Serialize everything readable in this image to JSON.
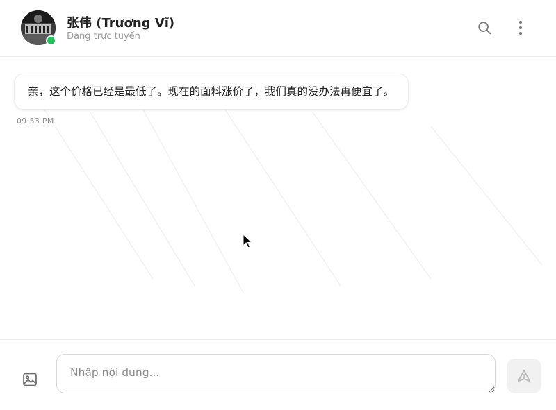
{
  "header": {
    "contact_name": "张伟 (Trương Vĩ)",
    "status": "Đang trực tuyến",
    "online_color": "#22c55e",
    "icons": [
      "avatar",
      "search-icon",
      "more-vertical-icon"
    ]
  },
  "messages": [
    {
      "direction": "incoming",
      "text": "亲，这个价格已经是最低了。现在的面料涨价了，我们真的没办法再便宜了。",
      "time": "09:53 PM"
    }
  ],
  "composer": {
    "placeholder": "Nhập nội dung...",
    "value": "",
    "icons": [
      "image-icon",
      "send-icon"
    ]
  }
}
